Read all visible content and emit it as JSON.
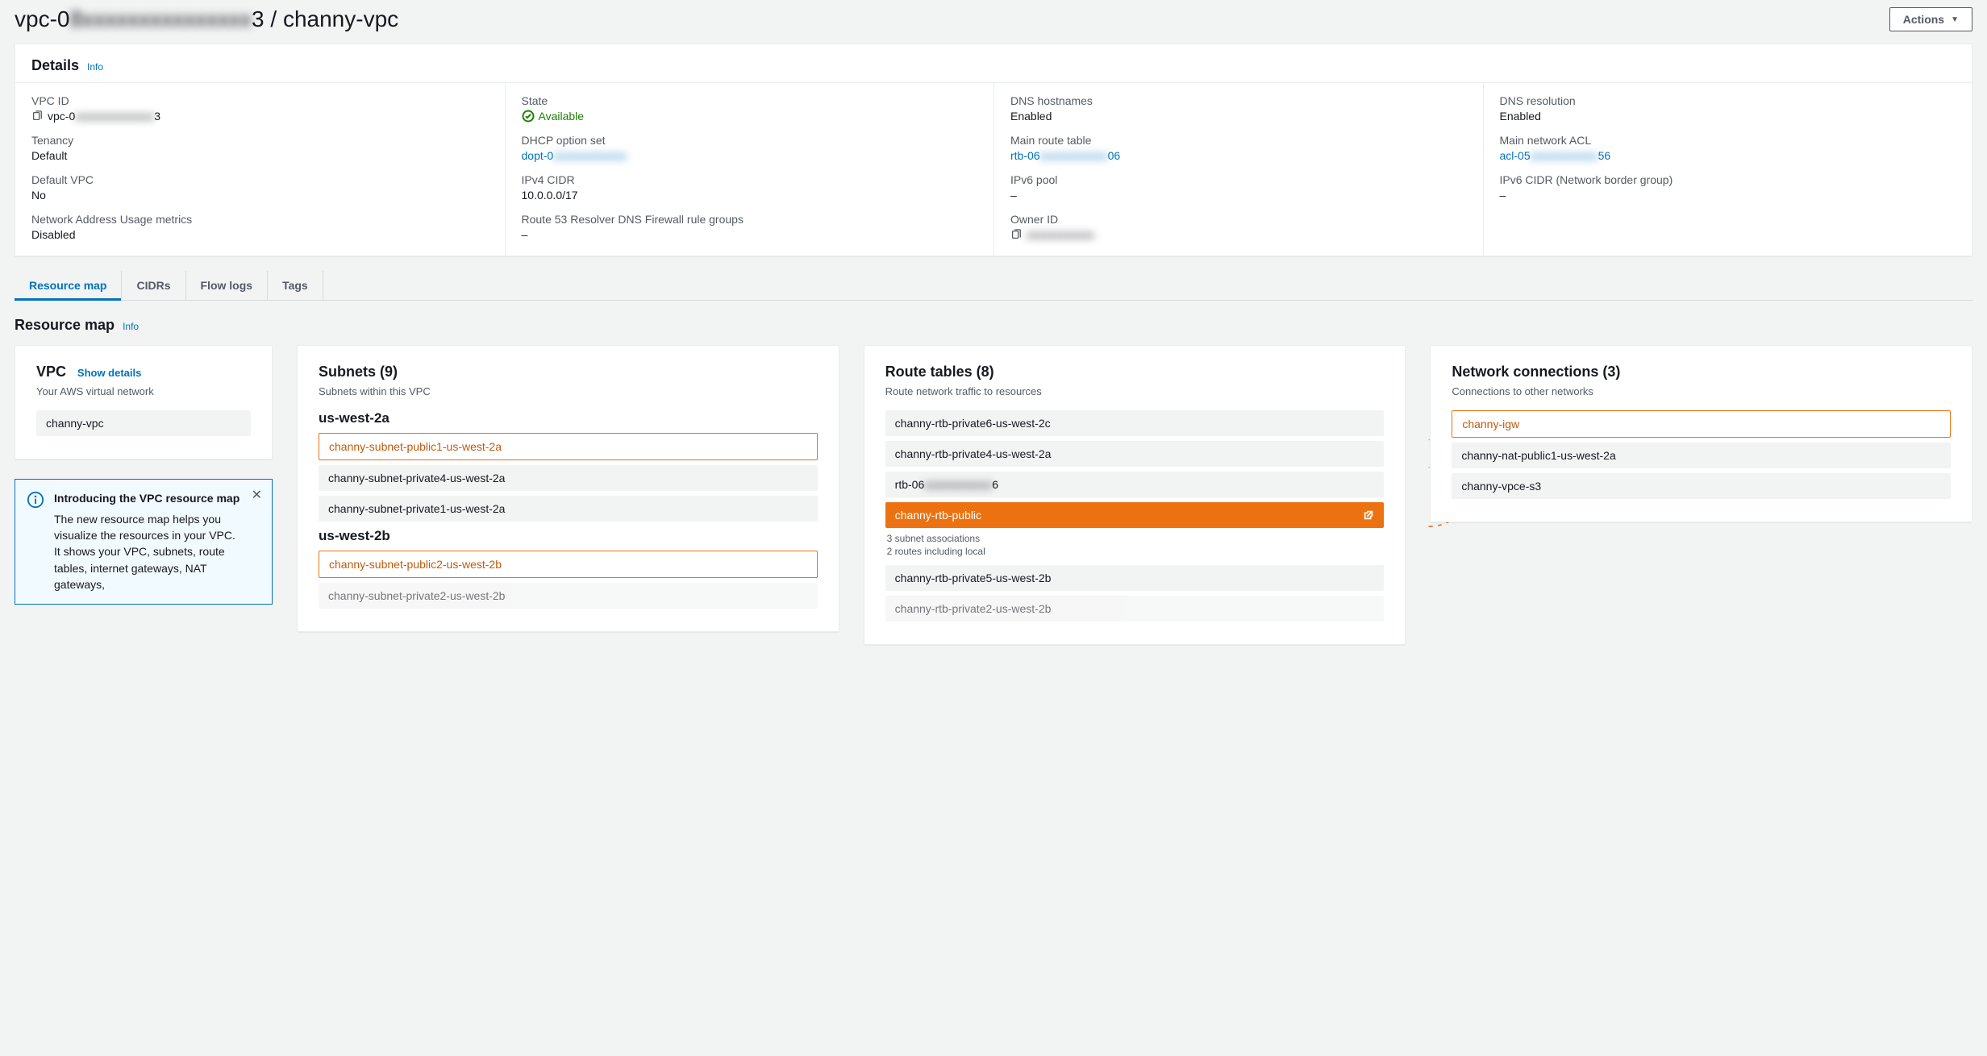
{
  "header": {
    "title_prefix": "vpc-0",
    "title_obscured": "8xxxxxxxxxxxxxxx",
    "title_suffix": "3 / channy-vpc",
    "actions_label": "Actions"
  },
  "details": {
    "title": "Details",
    "info": "Info",
    "fields": {
      "vpc_id_label": "VPC ID",
      "vpc_id_prefix": "vpc-0",
      "vpc_id_obscured": "xxxxxxxxxxxxxx",
      "vpc_id_suffix": "3",
      "state_label": "State",
      "state_value": "Available",
      "dns_hostnames_label": "DNS hostnames",
      "dns_hostnames_value": "Enabled",
      "dns_resolution_label": "DNS resolution",
      "dns_resolution_value": "Enabled",
      "tenancy_label": "Tenancy",
      "tenancy_value": "Default",
      "dhcp_label": "DHCP option set",
      "dhcp_prefix": "dopt-0",
      "dhcp_obscured": "xxxxxxxxxxxxx",
      "main_rt_label": "Main route table",
      "main_rt_prefix": "rtb-06",
      "main_rt_obscured": "xxxxxxxxxxxx",
      "main_rt_suffix": "06",
      "main_acl_label": "Main network ACL",
      "main_acl_prefix": "acl-05",
      "main_acl_obscured": "xxxxxxxxxxxx",
      "main_acl_suffix": "56",
      "default_vpc_label": "Default VPC",
      "default_vpc_value": "No",
      "ipv4_cidr_label": "IPv4 CIDR",
      "ipv4_cidr_value": "10.0.0.0/17",
      "ipv6_pool_label": "IPv6 pool",
      "ipv6_pool_value": "–",
      "ipv6_cidr_label": "IPv6 CIDR (Network border group)",
      "ipv6_cidr_value": "–",
      "nau_label": "Network Address Usage metrics",
      "nau_value": "Disabled",
      "r53_label": "Route 53 Resolver DNS Firewall rule groups",
      "r53_value": "–",
      "owner_label": "Owner ID",
      "owner_obscured": "xxxxxxxxxxxx"
    }
  },
  "tabs": [
    "Resource map",
    "CIDRs",
    "Flow logs",
    "Tags"
  ],
  "resource_map": {
    "title": "Resource map",
    "info": "Info",
    "vpc_col": {
      "title": "VPC",
      "show_details": "Show details",
      "sub": "Your AWS virtual network",
      "item": "channy-vpc"
    },
    "alert": {
      "title": "Introducing the VPC resource map",
      "body": "The new resource map helps you visualize the resources in your VPC. It shows your VPC, subnets, route tables, internet gateways, NAT gateways,"
    },
    "subnets_col": {
      "title": "Subnets (9)",
      "sub": "Subnets within this VPC",
      "groups": [
        {
          "az": "us-west-2a",
          "items": [
            {
              "name": "channy-subnet-public1-us-west-2a",
              "highlighted": true
            },
            {
              "name": "channy-subnet-private4-us-west-2a",
              "highlighted": false
            },
            {
              "name": "channy-subnet-private1-us-west-2a",
              "highlighted": false
            }
          ]
        },
        {
          "az": "us-west-2b",
          "items": [
            {
              "name": "channy-subnet-public2-us-west-2b",
              "highlighted": true
            },
            {
              "name": "channy-subnet-private2-us-west-2b",
              "highlighted": false
            }
          ]
        }
      ]
    },
    "rt_col": {
      "title": "Route tables (8)",
      "sub": "Route network traffic to resources",
      "items_before": [
        "channy-rtb-private6-us-west-2c",
        "channy-rtb-private4-us-west-2a"
      ],
      "rtb_obscured_prefix": "rtb-06",
      "rtb_obscured_mid": "xxxxxxxxxxxx",
      "rtb_obscured_suffix": "6",
      "selected": {
        "name": "channy-rtb-public",
        "meta1": "3 subnet associations",
        "meta2": "2 routes including local"
      },
      "items_after": [
        "channy-rtb-private5-us-west-2b",
        "channy-rtb-private2-us-west-2b"
      ]
    },
    "net_col": {
      "title": "Network connections (3)",
      "sub": "Connections to other networks",
      "items": [
        {
          "name": "channy-igw",
          "highlighted": true
        },
        {
          "name": "channy-nat-public1-us-west-2a",
          "highlighted": false
        },
        {
          "name": "channy-vpce-s3",
          "highlighted": false
        }
      ]
    }
  }
}
